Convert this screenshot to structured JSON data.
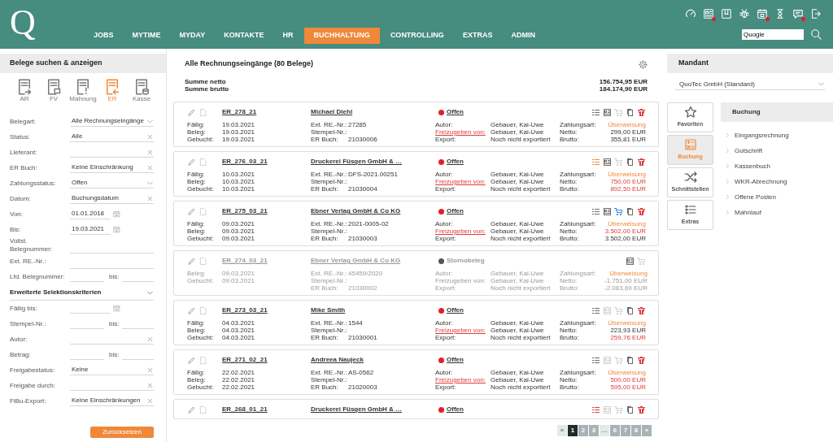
{
  "header": {
    "logo": "Q",
    "nav": [
      {
        "label": "JOBS",
        "selected": false
      },
      {
        "label": "MYTIME",
        "selected": false
      },
      {
        "label": "MYDAY",
        "selected": false
      },
      {
        "label": "KONTAKTE",
        "selected": false
      },
      {
        "label": "HR",
        "selected": false
      },
      {
        "label": "BUCHHALTUNG",
        "selected": true
      },
      {
        "label": "CONTROLLING",
        "selected": false
      },
      {
        "label": "EXTRAS",
        "selected": false
      },
      {
        "label": "ADMIN",
        "selected": false
      }
    ],
    "top_icons": [
      {
        "kind": "gauge",
        "notify": false
      },
      {
        "kind": "news",
        "notify": true
      },
      {
        "kind": "bookmark",
        "notify": false
      },
      {
        "kind": "bug",
        "notify": false
      },
      {
        "kind": "calendar",
        "notify": true
      },
      {
        "kind": "hourglass",
        "notify": false
      },
      {
        "kind": "chat",
        "notify": true
      },
      {
        "kind": "logout",
        "notify": false
      }
    ],
    "search": {
      "value": "Quogle"
    }
  },
  "search_panel": {
    "title": "Belege suchen & anzeigen",
    "doc_types": [
      {
        "label": "AR",
        "kind": "out",
        "selected": false
      },
      {
        "label": "FV",
        "kind": "note",
        "selected": false
      },
      {
        "label": "Mahnung",
        "kind": "alert",
        "selected": false
      },
      {
        "label": "ER",
        "kind": "in",
        "selected": true
      },
      {
        "label": "Kasse",
        "kind": "cash",
        "selected": false
      }
    ],
    "fields": [
      {
        "kind": "select",
        "label": "Belegart:",
        "value": "Alle Rechnungseingänge"
      },
      {
        "kind": "clear",
        "label": "Status:",
        "value": "Alle"
      },
      {
        "kind": "clear",
        "label": "Lieferant:"
      },
      {
        "kind": "clear",
        "label": "ER Buch:",
        "value": "Keine Einschränkung"
      },
      {
        "kind": "select",
        "label": "Zahlungsstatus:",
        "value": "Offen"
      },
      {
        "kind": "clear",
        "label": "Datum:",
        "value": "Buchungsdatum"
      },
      {
        "kind": "date",
        "label": "Von:",
        "value": "01.01.2018"
      },
      {
        "kind": "date",
        "label": "Bis:",
        "value": "19.03.2021"
      },
      {
        "kind": "text",
        "label": "Vollst. Belegnummer:"
      },
      {
        "kind": "text",
        "label": "Ext. RE.-Nr.:"
      },
      {
        "kind": "range",
        "label": "Lfd. Belegnummer:",
        "to_label": "bis:"
      },
      {
        "kind": "section",
        "label": "Erweiterte Selektionskriterien",
        "expanded": true
      },
      {
        "kind": "date",
        "label": "Fällig bis:"
      },
      {
        "kind": "range",
        "label": "Stempel-Nr.:",
        "to_label": "bis:"
      },
      {
        "kind": "clear",
        "label": "Autor:"
      },
      {
        "kind": "range",
        "label": "Betrag:",
        "to_label": "bis:"
      },
      {
        "kind": "clear",
        "label": "Freigabestatus:",
        "value": "Keine"
      },
      {
        "kind": "clear",
        "label": "Freigabe durch:"
      },
      {
        "kind": "clear",
        "label": "FiBu-Export:",
        "value": "Keine Einschränkungen"
      }
    ],
    "reset_button": "Zurücksetzen"
  },
  "documents": {
    "title": "Alle Rechnungseingänge (80 Belege)",
    "totals": [
      {
        "label": "Summe netto",
        "value": "156.754,95 EUR"
      },
      {
        "label": "Summe brutto",
        "value": "184.174,90 EUR"
      }
    ],
    "cards": [
      {
        "id": "ER_278_21",
        "supplier": "Michael Diehl",
        "status": {
          "label": "Offen",
          "kind": "open"
        },
        "cancelled": false,
        "dates": [
          {
            "label": "Fällig:",
            "value": "19.03.2021"
          },
          {
            "label": "Beleg:",
            "value": "19.03.2021"
          },
          {
            "label": "Gebucht:",
            "value": "19.03.2021"
          }
        ],
        "refs": [
          {
            "label": "Ext. RE.-Nr.:",
            "value": "27285"
          },
          {
            "label": "Stempel-Nr.:"
          },
          {
            "label": "ER Buch:",
            "value": "21030006"
          }
        ],
        "people": [
          {
            "label": "Autor:",
            "value": "Gebauer, Kai-Uwe",
            "link": false
          },
          {
            "label": "Freizugeben von:",
            "value": "Gebauer, Kai-Uwe",
            "link": true
          },
          {
            "label": "Export:",
            "value": "Noch nicht exportiert",
            "link": false
          }
        ],
        "payment": [
          {
            "label": "Zahlungsart:",
            "value": "Überweisung"
          },
          {
            "label": "Netto:",
            "value": "299,00 EUR",
            "flagged": false
          },
          {
            "label": "Brutto:",
            "value": "355,81 EUR",
            "flagged": false
          }
        ],
        "actions": [
          {
            "kind": "list",
            "color": "#6b6b6b"
          },
          {
            "kind": "receipt",
            "color": "#6b6b6b"
          },
          {
            "kind": "cart",
            "color": "#d2d2d2"
          },
          {
            "kind": "copy",
            "color": "#6b6b6b"
          },
          {
            "kind": "trash",
            "color": "#e0393b"
          }
        ]
      },
      {
        "id": "ER_276_03_21",
        "supplier": "Druckerei Füsgen GmbH & …",
        "status": {
          "label": "Offen",
          "kind": "open"
        },
        "cancelled": false,
        "dates": [
          {
            "label": "Fällig:",
            "value": "10.03.2021"
          },
          {
            "label": "Beleg:",
            "value": "10.03.2021"
          },
          {
            "label": "Gebucht:",
            "value": "10.03.2021"
          }
        ],
        "refs": [
          {
            "label": "Ext. RE.-Nr.:",
            "value": "DFS-2021.00251"
          },
          {
            "label": "Stempel-Nr.:"
          },
          {
            "label": "ER Buch:",
            "value": "21030004"
          }
        ],
        "people": [
          {
            "label": "Autor:",
            "value": "Gebauer, Kai-Uwe",
            "link": false
          },
          {
            "label": "Freizugeben von:",
            "value": "Gebauer, Kai-Uwe",
            "link": true
          },
          {
            "label": "Export:",
            "value": "Noch nicht exportiert",
            "link": false
          }
        ],
        "payment": [
          {
            "label": "Zahlungsart:",
            "value": "Überweisung"
          },
          {
            "label": "Netto:",
            "value": "750,00 EUR",
            "flagged": true
          },
          {
            "label": "Brutto:",
            "value": "892,50 EUR",
            "flagged": true
          }
        ],
        "actions": [
          {
            "kind": "list",
            "color": "#f0883a"
          },
          {
            "kind": "receipt",
            "color": "#6b6b6b"
          },
          {
            "kind": "cart",
            "color": "#d2d2d2"
          },
          {
            "kind": "copy",
            "color": "#6b6b6b"
          },
          {
            "kind": "trash",
            "color": "#e0393b"
          }
        ]
      },
      {
        "id": "ER_275_03_21",
        "supplier": "Ebner Verlag GmbH & Co KG",
        "status": {
          "label": "Offen",
          "kind": "open"
        },
        "cancelled": false,
        "dates": [
          {
            "label": "Fällig:",
            "value": "09.03.2021"
          },
          {
            "label": "Beleg:",
            "value": "09.03.2021"
          },
          {
            "label": "Gebucht:",
            "value": "09.03.2021"
          }
        ],
        "refs": [
          {
            "label": "Ext. RE.-Nr.:",
            "value": "2021-0005-02"
          },
          {
            "label": "Stempel-Nr.:"
          },
          {
            "label": "ER Buch:",
            "value": "21030003"
          }
        ],
        "people": [
          {
            "label": "Autor:",
            "value": "Gebauer, Kai-Uwe",
            "link": false
          },
          {
            "label": "Freizugeben von:",
            "value": "Gebauer, Kai-Uwe",
            "link": true
          },
          {
            "label": "Export:",
            "value": "Noch nicht exportiert",
            "link": false
          }
        ],
        "payment": [
          {
            "label": "Zahlungsart:",
            "value": "Überweisung"
          },
          {
            "label": "Netto:",
            "value": "3.502,00 EUR",
            "flagged": true
          },
          {
            "label": "Brutto:",
            "value": "3.502,00 EUR",
            "flagged": false
          }
        ],
        "actions": [
          {
            "kind": "list",
            "color": "#6b6b6b"
          },
          {
            "kind": "receipt",
            "color": "#6b6b6b"
          },
          {
            "kind": "cart",
            "color": "#3a8ee0"
          },
          {
            "kind": "copy",
            "color": "#6b6b6b"
          },
          {
            "kind": "trash",
            "color": "#e0393b"
          }
        ]
      },
      {
        "id": "ER_274_03_21",
        "supplier": "Ebner Verlag GmbH & Co KG",
        "status": {
          "label": "Stornobeleg",
          "kind": "storno"
        },
        "cancelled": true,
        "dates": [
          {
            "label": "Beleg:",
            "value": "09.03.2021"
          },
          {
            "label": "Gebucht:",
            "value": "09.03.2021"
          }
        ],
        "refs": [
          {
            "label": "Ext. RE.-Nr.:",
            "value": "45459/2020"
          },
          {
            "label": "Stempel-Nr.:"
          },
          {
            "label": "ER Buch:",
            "value": "21030002"
          }
        ],
        "people": [
          {
            "label": "Autor:",
            "value": "Gebauer, Kai-Uwe",
            "link": false
          },
          {
            "label": "Freizugeben von:",
            "value": "Gebauer, Kai-Uwe",
            "link": false
          },
          {
            "label": "Export:",
            "value": "Noch nicht exportiert",
            "link": false
          }
        ],
        "payment": [
          {
            "label": "Zahlungsart:",
            "value": "Überweisung"
          },
          {
            "label": "Netto:",
            "value": "-1.751,00 EUR",
            "flagged": false
          },
          {
            "label": "Brutto:",
            "value": "-2.083,69 EUR",
            "flagged": false
          }
        ],
        "actions": [
          {
            "kind": "receipt",
            "color": "#6b6b6b"
          },
          {
            "kind": "cart",
            "color": "#d2d2d2"
          }
        ]
      },
      {
        "id": "ER_273_03_21",
        "supplier": "Mike Smith",
        "status": {
          "label": "Offen",
          "kind": "open"
        },
        "cancelled": false,
        "dates": [
          {
            "label": "Fällig:",
            "value": "04.03.2021"
          },
          {
            "label": "Beleg:",
            "value": "04.03.2021"
          },
          {
            "label": "Gebucht:",
            "value": "04.03.2021"
          }
        ],
        "refs": [
          {
            "label": "Ext. RE.-Nr.:",
            "value": "1544"
          },
          {
            "label": "Stempel-Nr.:"
          },
          {
            "label": "ER Buch:",
            "value": "21030001"
          }
        ],
        "people": [
          {
            "label": "Autor:",
            "value": "Gebauer, Kai-Uwe",
            "link": false
          },
          {
            "label": "Freizugeben von:",
            "value": "Gebauer, Kai-Uwe",
            "link": true
          },
          {
            "label": "Export:",
            "value": "Noch nicht exportiert",
            "link": false
          }
        ],
        "payment": [
          {
            "label": "Zahlungsart:",
            "value": "Überweisung"
          },
          {
            "label": "Netto:",
            "value": "223,93 EUR",
            "flagged": false
          },
          {
            "label": "Brutto:",
            "value": "259,76 EUR",
            "flagged": true
          }
        ],
        "actions": [
          {
            "kind": "list",
            "color": "#6b6b6b"
          },
          {
            "kind": "receipt",
            "color": "#d2d2d2"
          },
          {
            "kind": "cart",
            "color": "#d2d2d2"
          },
          {
            "kind": "copy",
            "color": "#6b6b6b"
          },
          {
            "kind": "trash",
            "color": "#e0393b"
          }
        ]
      },
      {
        "id": "ER_271_02_21",
        "supplier": "Andreea Naujeck",
        "status": {
          "label": "Offen",
          "kind": "open"
        },
        "cancelled": false,
        "dates": [
          {
            "label": "Fällig:",
            "value": "22.02.2021"
          },
          {
            "label": "Beleg:",
            "value": "22.02.2021"
          },
          {
            "label": "Gebucht:",
            "value": "22.02.2021"
          }
        ],
        "refs": [
          {
            "label": "Ext. RE.-Nr.:",
            "value": "AS-0562"
          },
          {
            "label": "Stempel-Nr.:"
          },
          {
            "label": "ER Buch:",
            "value": "21020003"
          }
        ],
        "people": [
          {
            "label": "Autor:",
            "value": "Gebauer, Kai-Uwe",
            "link": false
          },
          {
            "label": "Freizugeben von:",
            "value": "Gebauer, Kai-Uwe",
            "link": true
          },
          {
            "label": "Export:",
            "value": "Noch nicht exportiert",
            "link": false
          }
        ],
        "payment": [
          {
            "label": "Zahlungsart:",
            "value": "Überweisung"
          },
          {
            "label": "Netto:",
            "value": "500,00 EUR",
            "flagged": true
          },
          {
            "label": "Brutto:",
            "value": "595,00 EUR",
            "flagged": true
          }
        ],
        "actions": [
          {
            "kind": "list",
            "color": "#6b6b6b"
          },
          {
            "kind": "receipt",
            "color": "#d2d2d2"
          },
          {
            "kind": "cart",
            "color": "#d2d2d2"
          },
          {
            "kind": "copy",
            "color": "#6b6b6b"
          },
          {
            "kind": "trash",
            "color": "#e0393b"
          }
        ]
      },
      {
        "id": "ER_268_01_21",
        "supplier": "Druckerei Füsgen GmbH & …",
        "status": {
          "label": "Offen",
          "kind": "open"
        },
        "cancelled": false,
        "actions": [
          {
            "kind": "list",
            "color": "#e0393b"
          },
          {
            "kind": "receipt",
            "color": "#d2d2d2"
          },
          {
            "kind": "cart",
            "color": "#d2d2d2"
          },
          {
            "kind": "copy",
            "color": "#6b6b6b"
          },
          {
            "kind": "trash",
            "color": "#e0393b"
          }
        ]
      }
    ],
    "pagination": [
      {
        "label": "«",
        "selected": false,
        "disabled": true
      },
      {
        "label": "1",
        "selected": true,
        "disabled": false
      },
      {
        "label": "2",
        "selected": false,
        "disabled": false
      },
      {
        "label": "3",
        "selected": false,
        "disabled": false
      },
      {
        "label": "…",
        "selected": false,
        "disabled": true
      },
      {
        "label": "6",
        "selected": false,
        "disabled": false
      },
      {
        "label": "7",
        "selected": false,
        "disabled": false
      },
      {
        "label": "8",
        "selected": false,
        "disabled": false
      },
      {
        "label": "»",
        "selected": false,
        "disabled": false
      }
    ]
  },
  "mandant_panel": {
    "title": "Mandant",
    "value": "QuoTec GmbH (Standard)",
    "tiles": [
      {
        "label": "Favoriten",
        "kind": "star",
        "selected": false
      },
      {
        "label": "Buchung",
        "kind": "calc",
        "selected": true
      },
      {
        "label": "Schnittstellen",
        "kind": "shuffle",
        "selected": false
      },
      {
        "label": "Extras",
        "kind": "olist",
        "selected": false
      }
    ],
    "menu": {
      "title": "Buchung",
      "items": [
        "Eingangsrechnung",
        "Gutschrift",
        "Kassenbuch",
        "WKR-Abrechnung",
        "Offene Posten",
        "Mahnlauf"
      ]
    }
  }
}
